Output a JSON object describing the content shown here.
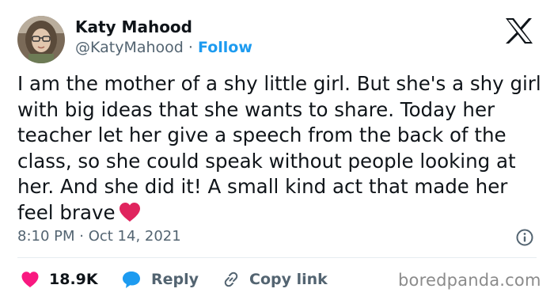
{
  "author": {
    "name": "Katy Mahood",
    "handle": "@KatyMahood",
    "separator": "·",
    "follow_label": "Follow"
  },
  "tweet": {
    "text": "I am the mother of a shy little girl. But she's a shy girl with big ideas that she wants to share. Today her teacher let her give a speech from the back of the class, so she could speak without people looking at her. And she did it! A small kind act that made her feel brave",
    "trailing_emoji": "red-heart-icon",
    "timestamp": "8:10 PM · Oct 14, 2021"
  },
  "actions": {
    "likes": "18.9K",
    "reply_label": "Reply",
    "copy_link_label": "Copy link"
  },
  "watermark": "boredpanda.com",
  "colors": {
    "accent": "#1d9bf0",
    "like": "#f91880",
    "text": "#0f1419",
    "muted": "#536471",
    "heart": "#e0245e"
  },
  "icons": [
    "x-logo-icon",
    "info-icon",
    "like-heart-icon",
    "reply-bubble-icon",
    "link-icon"
  ]
}
